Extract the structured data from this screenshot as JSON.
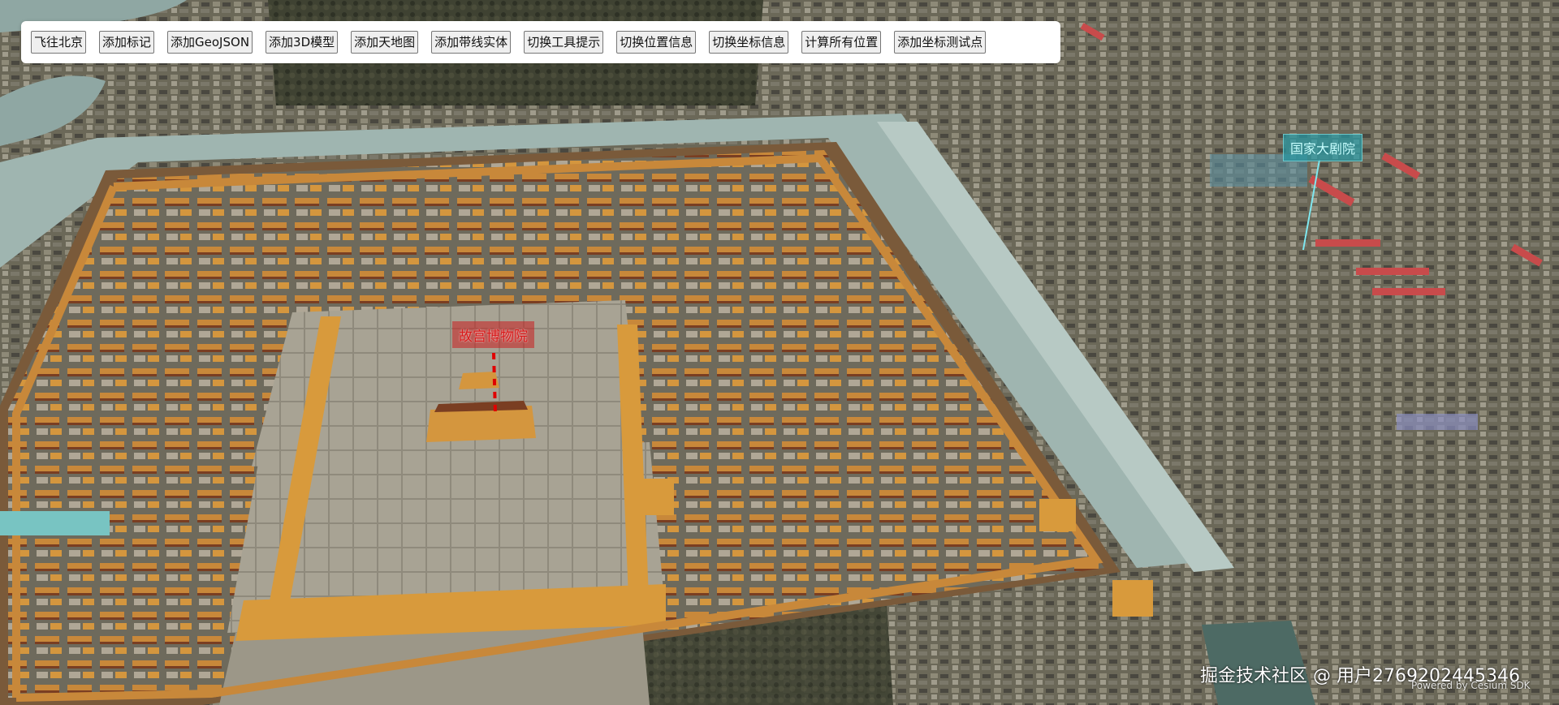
{
  "toolbar": {
    "buttons": [
      {
        "label": "飞往北京"
      },
      {
        "label": "添加标记"
      },
      {
        "label": "添加GeoJSON"
      },
      {
        "label": "添加3D模型"
      },
      {
        "label": "添加天地图"
      },
      {
        "label": "添加带线实体"
      },
      {
        "label": "切换工具提示"
      },
      {
        "label": "切换位置信息"
      },
      {
        "label": "切换坐标信息"
      },
      {
        "label": "计算所有位置"
      },
      {
        "label": "添加坐标测试点"
      }
    ]
  },
  "map": {
    "labels": {
      "palace": "故宫博物院",
      "theater": "国家大剧院"
    },
    "colors": {
      "palace_label": "#d81a1a",
      "theater_label": "#2896a0",
      "moat": "#9fb5b0",
      "roof": "#d89a3c",
      "wall": "#8a4a2a"
    }
  },
  "watermark": "掘金技术社区 @ 用户2769202445346",
  "credit": "Powered by Cesium SDK"
}
